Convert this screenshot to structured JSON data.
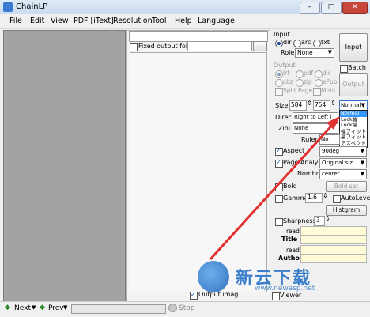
{
  "window": {
    "title": "ChainLP"
  },
  "menu": [
    "File",
    "Edit",
    "View",
    "PDF [iText]",
    "Resolution",
    "Tool",
    "Help",
    "Language"
  ],
  "window_buttons": {
    "min": "–",
    "max": "□",
    "close": "✕"
  },
  "middle": {
    "fixed_output_label": "Fixed output fold",
    "browse_label": "...",
    "output_image_label": "Output imag"
  },
  "input": {
    "group_label": "Input",
    "radio_dir": "dir",
    "radio_arc": "arc",
    "radio_txt": "txt",
    "role_label": "Role",
    "role_value": "None",
    "input_button": "Input",
    "batch_label": "Batch"
  },
  "output": {
    "group_label": "Output",
    "opt_lrf": "lrf",
    "opt_pdf": "pdf",
    "opt_dir": "dir",
    "opt_cbz": "cbz",
    "opt_zip": "zip",
    "opt_epub": "ePub",
    "split_label": "Split Page",
    "mobi_label": "Mobi",
    "output_button": "Output"
  },
  "size": {
    "label": "Size",
    "width": "584",
    "height": "754",
    "mode": "Normal"
  },
  "size_dropdown_options": [
    "Normal",
    "Lock幅",
    "Lock高",
    "幅フィット",
    "高フィット",
    "アスペクト比"
  ],
  "direction": {
    "label": "Direc",
    "value": "Right to Left ("
  },
  "zinl": {
    "label": "Zinl",
    "value": "None"
  },
  "ruler": {
    "label": "Ruler",
    "value": "No"
  },
  "aspect": {
    "label": "Aspect",
    "value": "90deg"
  },
  "page_analysis": {
    "label": "Page Analy",
    "value": "Original siz",
    "nombre_label": "Nombre",
    "nombre_value": "center"
  },
  "bold_row": {
    "label": "Bold",
    "button": "Bold set"
  },
  "gamma": {
    "label": "Gamma",
    "value": "1.6",
    "autolevel_label": "AutoLevel",
    "histgram_button": "Histgram"
  },
  "sharpness": {
    "label": "Sharpness",
    "value": "3"
  },
  "meta": {
    "reading1": "reading",
    "title_label": "Title",
    "reading2": "reading",
    "author_label": "Author"
  },
  "right_bottom": {
    "viewer_label": "Viewer"
  },
  "statusbar": {
    "next": "Next",
    "prev": "Prev",
    "stop": "Stop"
  },
  "watermark": {
    "text_cn": "新云下载",
    "url": "www.newasp.net"
  },
  "colors": {
    "accent": "#1a4fa0",
    "arrow": "#e03030",
    "watermark_blue": "#2a74c6"
  }
}
